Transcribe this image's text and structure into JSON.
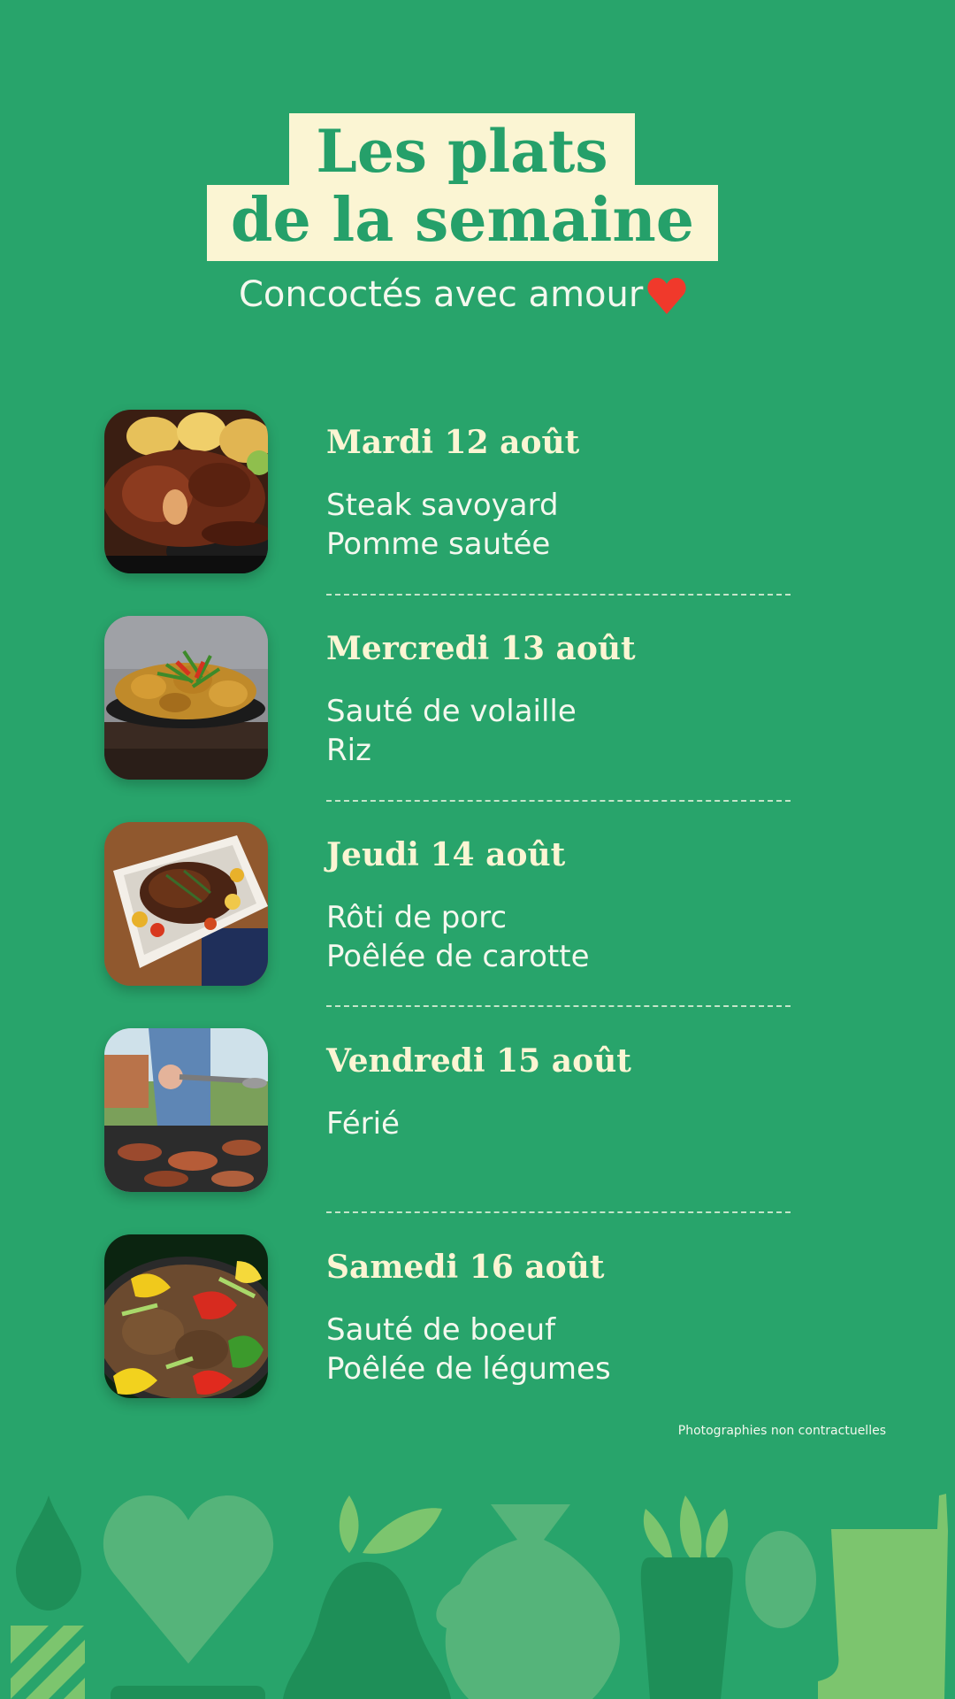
{
  "header": {
    "title_line1": "Les plats",
    "title_line2": "de la semaine",
    "subtitle": "Concoctés avec amour"
  },
  "meals": [
    {
      "date": "Mardi 12 août",
      "dish1": "Steak savoyard",
      "dish2": "Pomme sautée",
      "photo": "steak-photo"
    },
    {
      "date": "Mercredi 13 août",
      "dish1": "Sauté de volaille",
      "dish2": "Riz",
      "photo": "chicken-photo"
    },
    {
      "date": "Jeudi 14 août",
      "dish1": "Rôti de porc",
      "dish2": "Poêlée de carotte",
      "photo": "roast-photo"
    },
    {
      "date": "Vendredi 15 août",
      "dish1": "Férié",
      "dish2": "",
      "photo": "barbecue-photo"
    },
    {
      "date": "Samedi 16 août",
      "dish1": "Sauté de boeuf",
      "dish2": "Poêlée de légumes",
      "photo": "beef-vegetables-photo"
    }
  ],
  "footer": {
    "note": "Photographies non contractuelles"
  },
  "colors": {
    "background": "#28a46b",
    "title_box": "#fbf5d3",
    "title_text": "#25a06a",
    "heart": "#f0392b",
    "light_green": "#7cc56e",
    "dark_green": "#1e8f58"
  }
}
